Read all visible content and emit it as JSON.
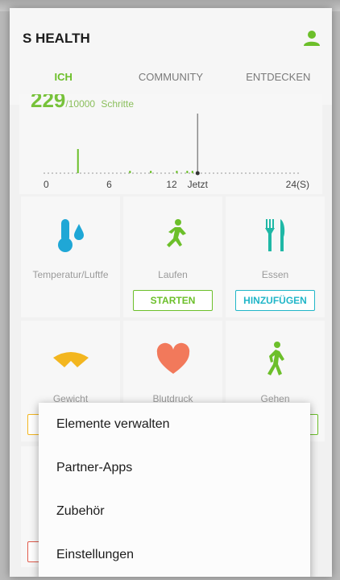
{
  "header": {
    "title": "S HEALTH"
  },
  "tabs": [
    {
      "label": "ICH"
    },
    {
      "label": "COMMUNITY"
    },
    {
      "label": "ENTDECKEN"
    }
  ],
  "steps": {
    "value": "229",
    "goal": "/10000",
    "unit": "Schritte"
  },
  "chart_data": {
    "type": "bar",
    "x_ticks": [
      "0",
      "6",
      "12",
      "Jetzt",
      "24(S)"
    ],
    "x": [
      3,
      8,
      10,
      12.5,
      13.5,
      14
    ],
    "values": [
      1,
      0.1,
      0.1,
      0.1,
      0.1,
      0.1
    ],
    "xlim": [
      0,
      24
    ],
    "now_hour": 14.5
  },
  "cells": [
    {
      "label": "Temperatur/Luftfe",
      "icon": "thermometer-droplet-icon"
    },
    {
      "label": "Laufen",
      "button": "STARTEN",
      "icon": "running-icon"
    },
    {
      "label": "Essen",
      "button": "HINZUFÜGEN",
      "icon": "fork-knife-icon"
    },
    {
      "label": "Gewicht",
      "icon": "scale-icon"
    },
    {
      "label": "Blutdruck",
      "icon": "heart-icon"
    },
    {
      "label": "Gehen",
      "icon": "walking-icon"
    }
  ],
  "menu": {
    "items": [
      "Elemente verwalten",
      "Partner-Apps",
      "Zubehör",
      "Einstellungen"
    ]
  },
  "colors": {
    "accent": "#6cbf2a",
    "teal": "#21b6c8",
    "blue": "#1fa7d6",
    "yellow": "#f3b61f",
    "coral": "#f2795b",
    "red": "#e05a4b"
  }
}
